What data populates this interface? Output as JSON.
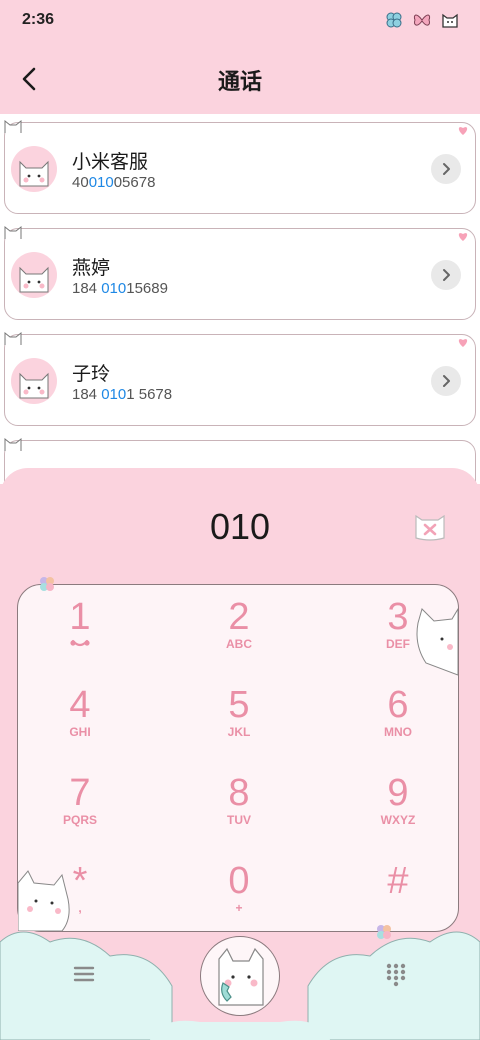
{
  "status_bar": {
    "time": "2:36"
  },
  "header": {
    "title": "通话"
  },
  "contacts": [
    {
      "name": "小米客服",
      "number_pre": "40",
      "number_match": "010",
      "number_post": "05678"
    },
    {
      "name": "燕婷",
      "number_pre": "184 ",
      "number_match": "010",
      "number_post": "15689"
    },
    {
      "name": "子玲",
      "number_pre": "184 ",
      "number_match": "010",
      "number_post": "1 5678"
    }
  ],
  "dialer": {
    "display": "010",
    "keys": [
      {
        "digit": "1",
        "letters": ""
      },
      {
        "digit": "2",
        "letters": "ABC"
      },
      {
        "digit": "3",
        "letters": "DEF"
      },
      {
        "digit": "4",
        "letters": "GHI"
      },
      {
        "digit": "5",
        "letters": "JKL"
      },
      {
        "digit": "6",
        "letters": "MNO"
      },
      {
        "digit": "7",
        "letters": "PQRS"
      },
      {
        "digit": "8",
        "letters": "TUV"
      },
      {
        "digit": "9",
        "letters": "WXYZ"
      },
      {
        "digit": "*",
        "letters": ","
      },
      {
        "digit": "0",
        "letters": "+"
      },
      {
        "digit": "#",
        "letters": ""
      }
    ]
  },
  "colors": {
    "background_pink": "#fbd3de",
    "key_pink": "#ea8fa6",
    "match_blue": "#1e88e5",
    "cloud_mint": "#dff6f3"
  },
  "icons": [
    "clover-icon",
    "butterfly-icon",
    "cat-icon",
    "back-arrow-icon",
    "chevron-right-icon",
    "delete-icon",
    "menu-icon",
    "call-icon",
    "dialpad-icon"
  ]
}
